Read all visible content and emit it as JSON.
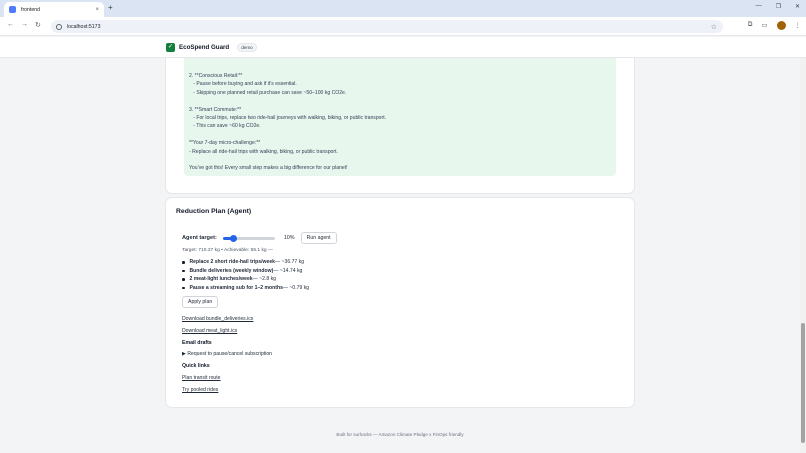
{
  "browser": {
    "tab_title": "frontend",
    "url": "localhost:5173",
    "new_tab": "+",
    "tab_close": "×",
    "window_controls": [
      "—",
      "❐",
      "✕"
    ],
    "nav": {
      "back": "←",
      "forward": "→",
      "reload": "↻"
    }
  },
  "header": {
    "logo_glyph": "✓",
    "title": "EcoSpend Guard",
    "badge": "demo"
  },
  "advice": {
    "lines": [
      "2. **Conscious Retail:**",
      "   - Pause before buying and ask if it’s essential.",
      "   - Skipping one planned retail purchase can save ~50–100 kg CO2e.",
      "",
      "3. **Smart Commute:**",
      "   - For local trips, replace two ride-hail journeys with walking, biking, or public transport.",
      "   - This can save ~60 kg CO2e.",
      "",
      "**Your 7-day micro-challenge:**",
      "- Replace all ride-hail trips with walking, biking, or public transport.",
      "",
      "You’ve got this! Every small step makes a big difference for our planet!"
    ]
  },
  "plan": {
    "title": "Reduction Plan (Agent)",
    "target_label": "Agent target:",
    "target_value": 10,
    "target_pct_label": "10%",
    "run_label": "Run agent",
    "target_info": "Target: 710.27 kg • Achievable: 55.1 kg",
    "target_info_badge": "—",
    "actions": [
      {
        "name": "Replace 2 short ride-hail trips/week",
        "saving": " — ~36.77 kg"
      },
      {
        "name": "Bundle deliveries (weekly window)",
        "saving": " — ~14.74 kg"
      },
      {
        "name": "2 meat-light lunches/week",
        "saving": " — ~2.8 kg"
      },
      {
        "name": "Pause a streaming sub for 1–2 months",
        "saving": " — ~0.79 kg"
      }
    ],
    "apply_label": "Apply plan",
    "downloads": [
      "Download bundle_deliveries.ics",
      "Download meat_light.ics"
    ],
    "email_heading": "Email drafts",
    "email_draft": "▶ Request to pause/cancel subscription",
    "quick_heading": "Quick links",
    "quick_links": [
      "Plan transit route",
      "Try pooled rides"
    ]
  },
  "footer": "Built for surhacks — Amazon Climate Pledge x FinOps friendly",
  "colors": {
    "accent": "#2563eb",
    "advice_bg": "#e8f7ee",
    "logo": "#15803d"
  }
}
